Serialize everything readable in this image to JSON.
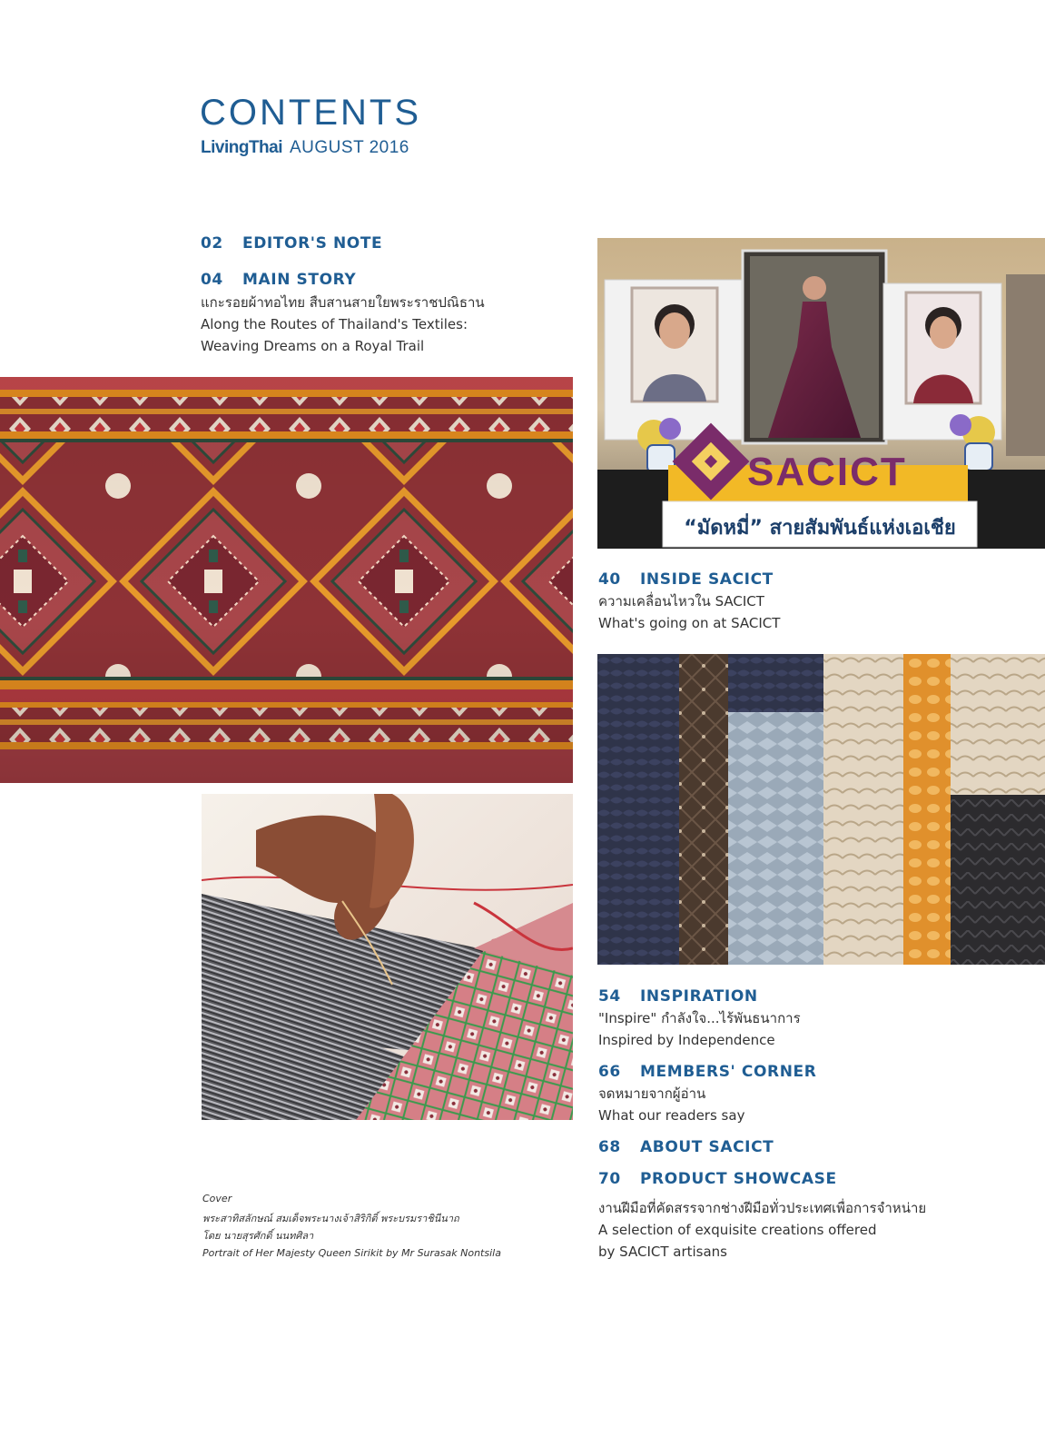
{
  "header": {
    "title": "CONTENTS",
    "brand": "LivingThai",
    "issue": "AUGUST 2016"
  },
  "toc": [
    {
      "num": "02",
      "title": "EDITOR'S NOTE",
      "lines": []
    },
    {
      "num": "04",
      "title": "MAIN STORY",
      "lines": [
        "แกะรอยผ้าทอไทย สืบสานสายใยพระราชปณิธาน",
        "Along the Routes of Thailand's Textiles:",
        "Weaving Dreams on a Royal Trail"
      ]
    },
    {
      "num": "40",
      "title": "INSIDE SACICT",
      "lines": [
        "ความเคลื่อนไหวใน SACICT",
        "What's going on at SACICT"
      ]
    },
    {
      "num": "54",
      "title": "INSPIRATION",
      "lines": [
        "\"Inspire\" กำลังใจ...ไร้พันธนาการ",
        "Inspired by Independence"
      ]
    },
    {
      "num": "66",
      "title": "MEMBERS' CORNER",
      "lines": [
        "จดหมายจากผู้อ่าน",
        "What our readers say"
      ]
    },
    {
      "num": "68",
      "title": "ABOUT SACICT",
      "lines": []
    },
    {
      "num": "70",
      "title": "PRODUCT SHOWCASE",
      "lines": [
        "งานฝีมือที่คัดสรรจากช่างฝีมือทั่วประเทศเพื่อการจำหน่าย",
        "A selection of exquisite creations offered",
        "by SACICT artisans"
      ]
    }
  ],
  "cover": {
    "label": "Cover",
    "line1": "พระสาทิสลักษณ์ สมเด็จพระนางเจ้าสิริกิติ์ พระบรมราชินีนาถ",
    "line2": "โดย นายสุรศักดิ์ นนทศิลา",
    "line3": "Portrait of Her Majesty Queen Sirikit by Mr Surasak Nontsila"
  },
  "images": {
    "sacict_banner_logo": "SACICT",
    "sacict_banner_caption": "“มัดหมี่” สายสัมพันธ์แห่งเอเชีย"
  },
  "colors": {
    "accent": "#1f5d93",
    "textile_red": "#9a3a3c",
    "textile_orange": "#e08a1e",
    "logo_purple": "#7a2c6a"
  }
}
